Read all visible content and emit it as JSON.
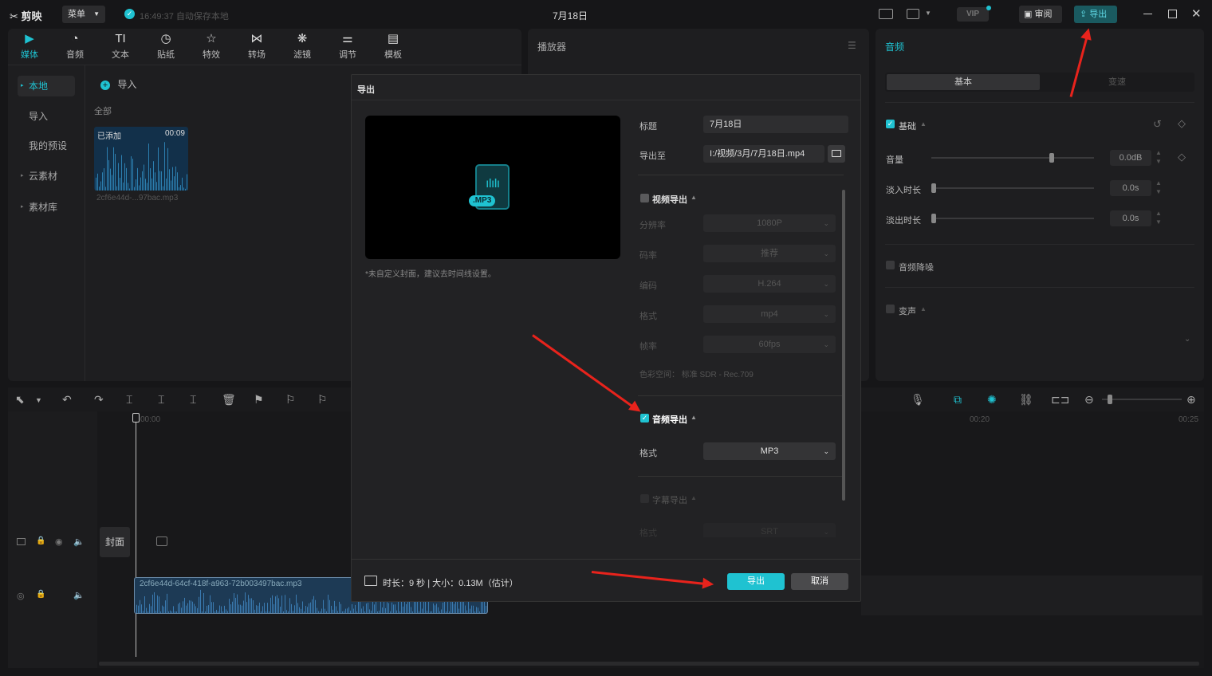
{
  "app": {
    "logo": "剪映",
    "menu": "菜单",
    "autosave": "16:49:37 自动保存本地",
    "title": "7月18日",
    "review": "审阅",
    "export": "导出"
  },
  "toolbar": [
    {
      "label": "媒体",
      "icon": "media-icon"
    },
    {
      "label": "音频",
      "icon": "audio-icon"
    },
    {
      "label": "文本",
      "icon": "text-icon"
    },
    {
      "label": "贴纸",
      "icon": "sticker-icon"
    },
    {
      "label": "特效",
      "icon": "effects-icon"
    },
    {
      "label": "转场",
      "icon": "transition-icon"
    },
    {
      "label": "滤镜",
      "icon": "filter-icon"
    },
    {
      "label": "调节",
      "icon": "adjust-icon"
    },
    {
      "label": "模板",
      "icon": "template-icon"
    }
  ],
  "sidebar": {
    "items": [
      "本地",
      "导入",
      "我的预设",
      "云素材",
      "素材库"
    ]
  },
  "media": {
    "import": "导入",
    "filter": "全部",
    "added_badge": "已添加",
    "duration": "00:09",
    "filename": "2cf6e44d-...97bac.mp3"
  },
  "player": {
    "title": "播放器"
  },
  "audio_panel": {
    "title": "音频",
    "tabs": [
      "基本",
      "变速"
    ],
    "basic": "基础",
    "volume": {
      "label": "音量",
      "value": "0.0dB"
    },
    "fade_in": {
      "label": "淡入时长",
      "value": "0.0s"
    },
    "fade_out": {
      "label": "淡出时长",
      "value": "0.0s"
    },
    "denoise": "音频降噪",
    "voice_change": "变声"
  },
  "timeline": {
    "t0": "00:00",
    "t20": "00:20",
    "t25": "00:25",
    "cover": "封面",
    "clip_name": "2cf6e44d-64cf-418f-a963-72b003497bac.mp3"
  },
  "dialog": {
    "title": "导出",
    "cover_badge": ".MP3",
    "cover_hint": "*未自定义封面，建议去时间线设置。",
    "name_label": "标题",
    "name_value": "7月18日",
    "path_label": "导出至",
    "path_value": "I:/视频/3月/7月18日.mp4",
    "video_export": "视频导出",
    "resolution": {
      "label": "分辨率",
      "value": "1080P"
    },
    "bitrate": {
      "label": "码率",
      "value": "推荐"
    },
    "codec": {
      "label": "编码",
      "value": "H.264"
    },
    "format": {
      "label": "格式",
      "value": "mp4"
    },
    "framerate": {
      "label": "帧率",
      "value": "60fps"
    },
    "color_space": "色彩空间：  标准 SDR - Rec.709",
    "audio_export": "音频导出",
    "audio_format": {
      "label": "格式",
      "value": "MP3"
    },
    "subtitle_export": "字幕导出",
    "subtitle_format": {
      "label": "格式",
      "value": "SRT"
    },
    "footer_info": "时长：9 秒 | 大小：0.13M（估计）",
    "export_button": "导出",
    "cancel_button": "取消"
  },
  "colors": {
    "accent": "#1fc2d1",
    "arrow": "#e8231c",
    "panel": "#1e1e20",
    "dialog": "#222224"
  }
}
